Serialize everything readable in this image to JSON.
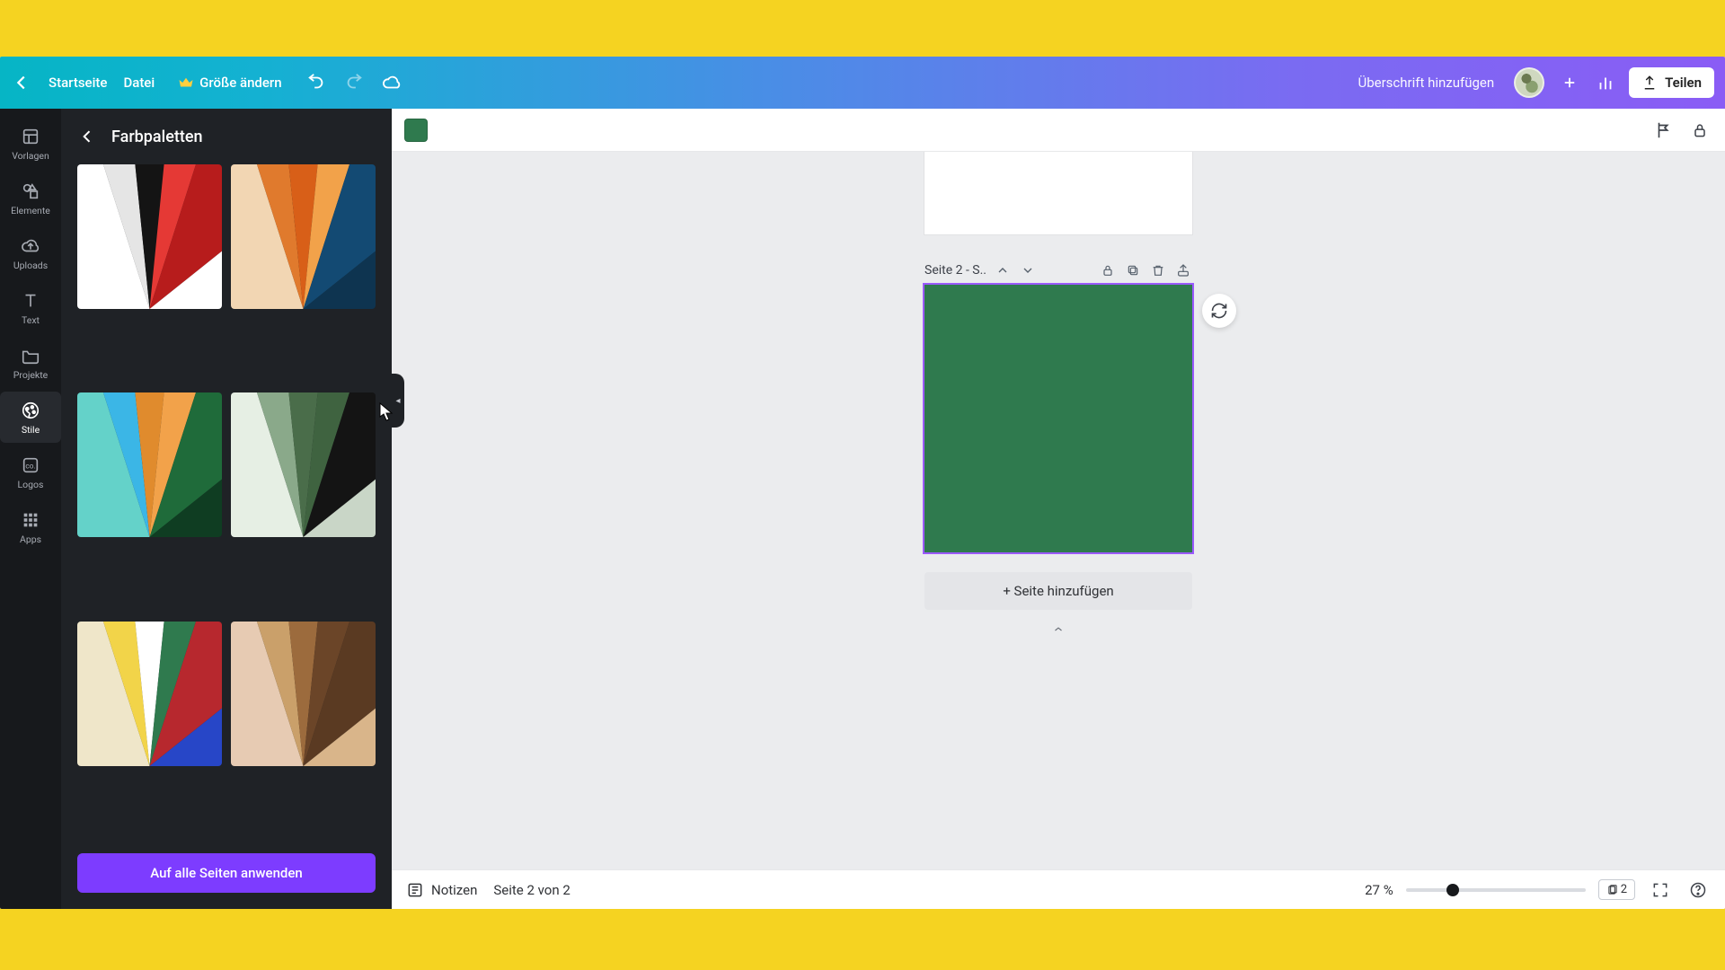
{
  "topbar": {
    "home": "Startseite",
    "file": "Datei",
    "resize": "Größe ändern",
    "doc_title": "Überschrift hinzufügen",
    "share": "Teilen"
  },
  "rail": {
    "templates": "Vorlagen",
    "elements": "Elemente",
    "uploads": "Uploads",
    "text": "Text",
    "projects": "Projekte",
    "styles": "Stile",
    "logos": "Logos",
    "apps": "Apps"
  },
  "panel": {
    "title": "Farbpaletten",
    "apply": "Auf alle Seiten anwenden"
  },
  "palettes": [
    {
      "name": "palette-red-black",
      "colors": [
        "#ffffff",
        "#e5e5e5",
        "#141414",
        "#e53935",
        "#b71c1c",
        "#ffffff"
      ]
    },
    {
      "name": "palette-orange-navy",
      "colors": [
        "#f2d6b3",
        "#e07a2d",
        "#d85f18",
        "#f2a24a",
        "#134a73",
        "#0e3450"
      ]
    },
    {
      "name": "palette-teal-orange",
      "colors": [
        "#64d2c9",
        "#3bb6e6",
        "#e08b2d",
        "#f2a24a",
        "#1f6b3a",
        "#0f3d22"
      ]
    },
    {
      "name": "palette-green-black",
      "colors": [
        "#e6efe4",
        "#8aa98a",
        "#4a6d4a",
        "#3f6340",
        "#141414",
        "#c9d6c7"
      ]
    },
    {
      "name": "palette-primary-mix",
      "colors": [
        "#efe6c9",
        "#f2d449",
        "#ffffff",
        "#2f7a4e",
        "#b7282e",
        "#2746c7"
      ]
    },
    {
      "name": "palette-browns",
      "colors": [
        "#e7cbb3",
        "#caa06a",
        "#9c6b3d",
        "#6b4528",
        "#5a3a22",
        "#d9b58a"
      ]
    }
  ],
  "canvas": {
    "page_label": "Seite 2 - S..",
    "add_page": "+ Seite hinzufügen",
    "bg_color": "#2f7a4e"
  },
  "bottombar": {
    "notes": "Notizen",
    "page_of": "Seite 2 von 2",
    "zoom": "27 %",
    "page_badge": "2"
  }
}
